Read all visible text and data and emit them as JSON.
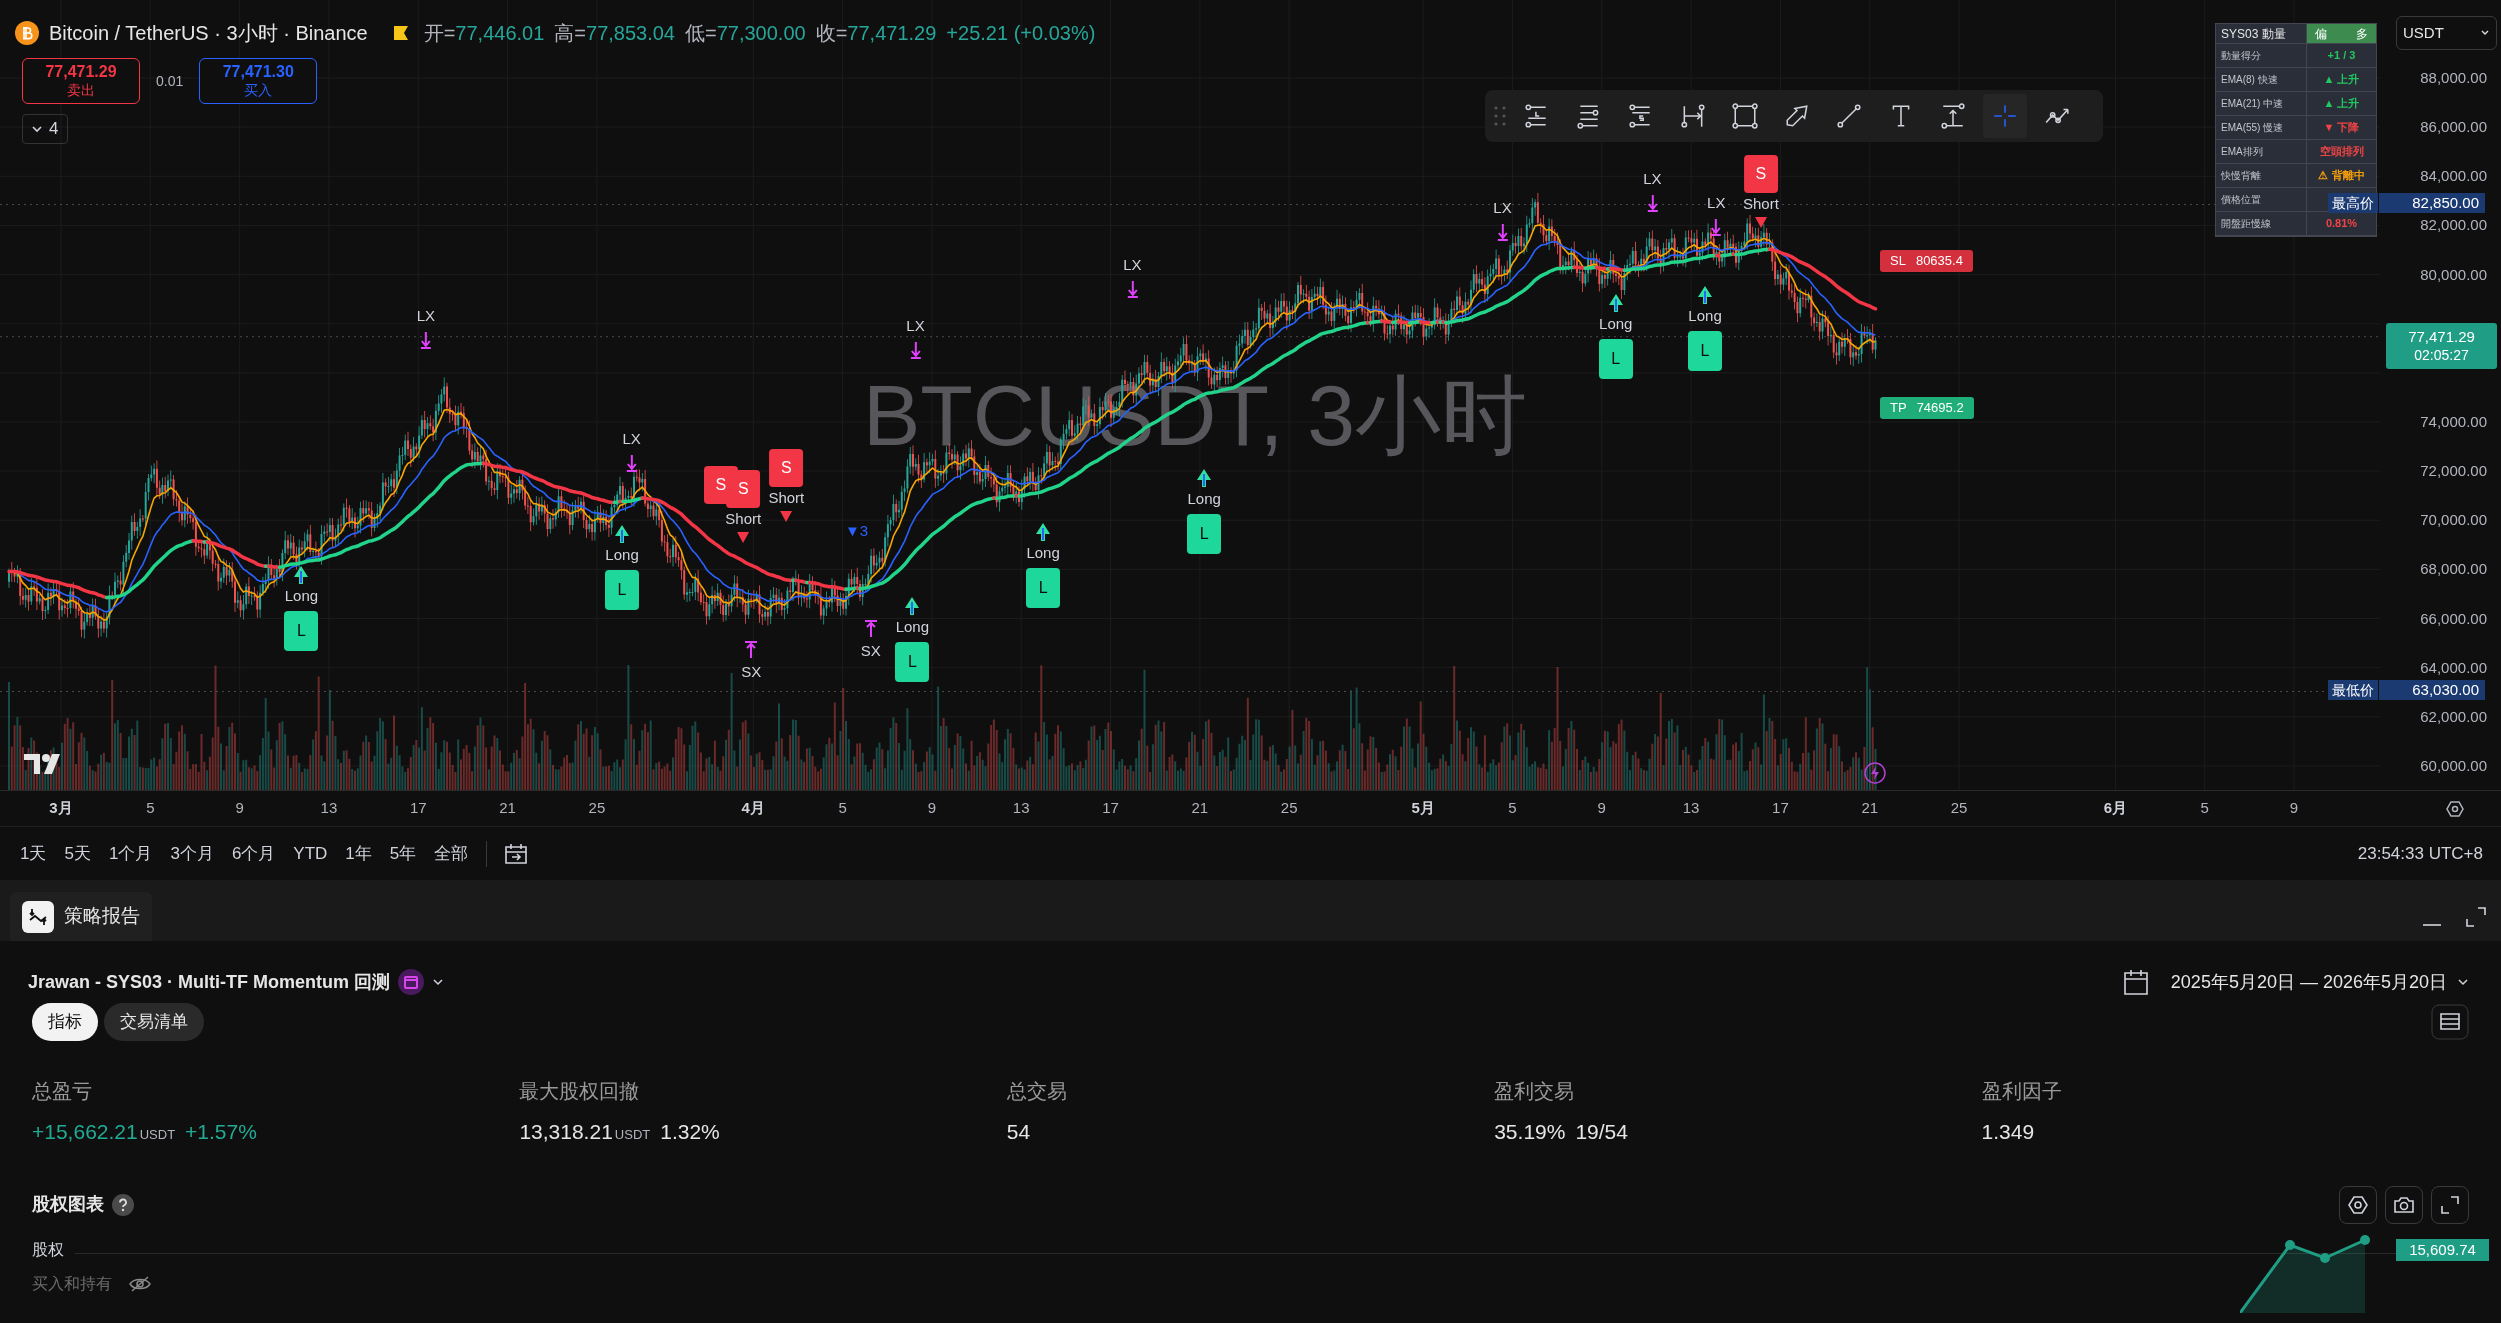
{
  "header": {
    "title": "Bitcoin / TetherUS · 3小时 · Binance",
    "ohlc": [
      {
        "label": "开=",
        "value": "77,446.01"
      },
      {
        "label": "高=",
        "value": "77,853.04"
      },
      {
        "label": "低=",
        "value": "77,300.00"
      },
      {
        "label": "收=",
        "value": "77,471.29"
      }
    ],
    "change": "+25.21 (+0.03%)",
    "sell": {
      "price": "77,471.29",
      "label": "卖出"
    },
    "spread": "0.01",
    "buy": {
      "price": "77,471.30",
      "label": "买入"
    },
    "indicators_count": "4"
  },
  "symbol_overlay": "BTCUSDT, 3小时",
  "drawing_tools": [
    {
      "kind": "long",
      "selected": false
    },
    {
      "kind": "fib",
      "selected": false
    },
    {
      "kind": "short",
      "selected": false
    },
    {
      "kind": "date_range",
      "selected": false
    },
    {
      "kind": "rectangle",
      "selected": false
    },
    {
      "kind": "arrow",
      "selected": false
    },
    {
      "kind": "trend_line",
      "selected": false
    },
    {
      "kind": "text",
      "selected": false
    },
    {
      "kind": "price_range",
      "selected": false
    },
    {
      "kind": "crosshair",
      "selected": true
    },
    {
      "kind": "path",
      "selected": false
    }
  ],
  "indicator_table": {
    "title": "SYS03 動量",
    "bias": [
      "偏",
      "多"
    ],
    "rows": [
      {
        "label": "動量得分",
        "value": "+1 / 3",
        "color": "#22c55e"
      },
      {
        "label": "EMA(8) 快速",
        "value": "▲ 上升",
        "color": "#22c55e"
      },
      {
        "label": "EMA(21) 中速",
        "value": "▲ 上升",
        "color": "#22c55e"
      },
      {
        "label": "EMA(55) 慢速",
        "value": "▼ 下降",
        "color": "#ef4444"
      },
      {
        "label": "EMA排列",
        "value": "空頭排列",
        "color": "#ef4444"
      },
      {
        "label": "快慢背離",
        "value": "⚠ 背離中",
        "color": "#f59e0b"
      },
      {
        "label": "價格位置"
      },
      {
        "label": "開盤距慢線",
        "value": "0.81%",
        "color": "#ef4444"
      }
    ]
  },
  "markers": [
    {
      "kind": "exit",
      "text": "LX"
    },
    {
      "kind": "exit",
      "text": "LX"
    },
    {
      "kind": "exit",
      "text": "LX"
    },
    {
      "kind": "exit",
      "text": "LX"
    },
    {
      "kind": "exit",
      "text": "LX"
    },
    {
      "kind": "exit",
      "text": "LX"
    },
    {
      "kind": "exit",
      "text": "LX"
    },
    {
      "kind": "long",
      "text": "Long",
      "tag": "L"
    },
    {
      "kind": "long",
      "text": "Long",
      "tag": "L"
    },
    {
      "kind": "long",
      "text": "Long",
      "tag": "L"
    },
    {
      "kind": "long",
      "text": "Long",
      "tag": "L"
    },
    {
      "kind": "long",
      "text": "Long",
      "tag": "L"
    },
    {
      "kind": "long",
      "text": "Long",
      "tag": "L"
    },
    {
      "kind": "long",
      "text": "Long",
      "tag": "L"
    },
    {
      "kind": "short",
      "tag": "S"
    },
    {
      "kind": "short",
      "text": "Short",
      "tag": "S"
    },
    {
      "kind": "short",
      "text": "Short",
      "tag": "S"
    },
    {
      "kind": "short",
      "text": "Short",
      "tag": "S"
    },
    {
      "kind": "cover",
      "text": "SX"
    },
    {
      "kind": "cover",
      "text": "SX"
    },
    {
      "kind": "count",
      "text": "▼3"
    }
  ],
  "levels": [
    {
      "kind": "stop",
      "label": "SL",
      "value": "80635.4"
    },
    {
      "kind": "target",
      "label": "TP",
      "value": "74695.2"
    }
  ],
  "price_axis": {
    "currency": "USDT",
    "ticks": [
      "88,000.00",
      "86,000.00",
      "84,000.00",
      "82,000.00",
      "80,000.00",
      "74,000.00",
      "72,000.00",
      "70,000.00",
      "68,000.00",
      "66,000.00",
      "64,000.00",
      "62,000.00",
      "60,000.00"
    ],
    "high": {
      "label": "最高价",
      "value": "82,850.00"
    },
    "low": {
      "label": "最低价",
      "value": "63,030.00"
    },
    "last": {
      "price": "77,471.29",
      "countdown": "02:05:27"
    }
  },
  "time_axis": [
    {
      "text": "3月",
      "kind": "month"
    },
    {
      "text": "5",
      "kind": "day"
    },
    {
      "text": "9",
      "kind": "day"
    },
    {
      "text": "13",
      "kind": "day"
    },
    {
      "text": "17",
      "kind": "day"
    },
    {
      "text": "21",
      "kind": "day"
    },
    {
      "text": "25",
      "kind": "day"
    },
    {
      "text": "4月",
      "kind": "month"
    },
    {
      "text": "5",
      "kind": "day"
    },
    {
      "text": "9",
      "kind": "day"
    },
    {
      "text": "13",
      "kind": "day"
    },
    {
      "text": "17",
      "kind": "day"
    },
    {
      "text": "21",
      "kind": "day"
    },
    {
      "text": "25",
      "kind": "day"
    },
    {
      "text": "5月",
      "kind": "month"
    },
    {
      "text": "5",
      "kind": "day"
    },
    {
      "text": "9",
      "kind": "day"
    },
    {
      "text": "13",
      "kind": "day"
    },
    {
      "text": "17",
      "kind": "day"
    },
    {
      "text": "21",
      "kind": "day"
    },
    {
      "text": "25",
      "kind": "day"
    },
    {
      "text": "6月",
      "kind": "month"
    },
    {
      "text": "5",
      "kind": "day"
    },
    {
      "text": "9",
      "kind": "day"
    }
  ],
  "ranges": [
    "1天",
    "5天",
    "1个月",
    "3个月",
    "6个月",
    "YTD",
    "1年",
    "5年",
    "全部"
  ],
  "clock": "23:54:33 UTC+8",
  "report": {
    "tab": "策略报告",
    "strategy": "Jrawan - SYS03 · Multi-TF Momentum 回测",
    "date_range": "2025年5月20日 — 2026年5月20日",
    "tabs": [
      {
        "label": "指标",
        "selected": true
      },
      {
        "label": "交易清单",
        "selected": false
      }
    ],
    "metrics": [
      {
        "label": "总盈亏",
        "parts": [
          {
            "kind": "gain",
            "text": "+15,662.21"
          },
          {
            "kind": "unit",
            "text": "USDT"
          },
          {
            "kind": "gain",
            "text": "+1.57%"
          }
        ]
      },
      {
        "label": "最大股权回撤",
        "parts": [
          {
            "kind": "value",
            "text": "13,318.21"
          },
          {
            "kind": "unit",
            "text": "USDT"
          },
          {
            "kind": "value",
            "text": "1.32%"
          }
        ]
      },
      {
        "label": "总交易",
        "parts": [
          {
            "kind": "value",
            "text": "54"
          }
        ]
      },
      {
        "label": "盈利交易",
        "parts": [
          {
            "kind": "value",
            "text": "35.19%"
          },
          {
            "kind": "value",
            "text": "19/54"
          }
        ]
      },
      {
        "label": "盈利因子",
        "parts": [
          {
            "kind": "value",
            "text": "1.349"
          }
        ]
      }
    ],
    "equity_title": "股权图表",
    "series": [
      {
        "label": "股权",
        "hidden": false
      },
      {
        "label": "买入和持有",
        "hidden": true
      }
    ],
    "equity_last": "15,609.74"
  }
}
